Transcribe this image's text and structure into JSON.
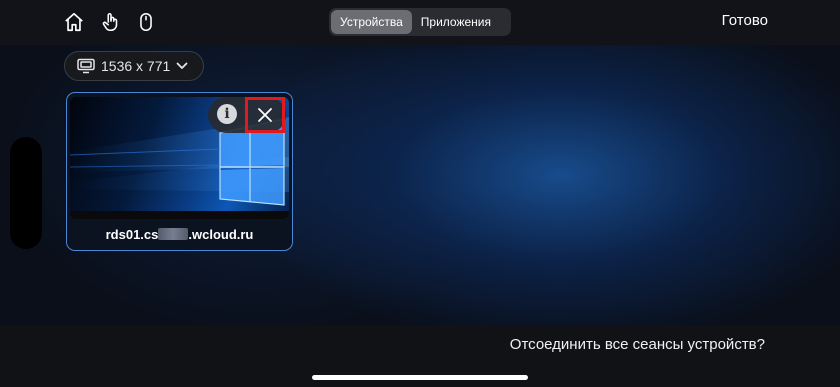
{
  "toolbar": {
    "icons": [
      "home-icon",
      "touch-hand-icon",
      "mouse-icon"
    ],
    "tabs": [
      {
        "label": "Устройства",
        "active": true
      },
      {
        "label": "Приложения",
        "active": false
      }
    ],
    "done_label": "Готово"
  },
  "resolution": {
    "label": "1536 x 771",
    "icon": "display-icon",
    "chevron": "chevron-down-icon"
  },
  "session_card": {
    "name_prefix": "rds01.cs",
    "name_suffix": ".wcloud.ru",
    "info_glyph": "i",
    "info_icon": "info-icon",
    "close_icon": "close-icon",
    "close_highlight_color": "#e2191e"
  },
  "footer": {
    "disconnect_all_label": "Отсоединить все сеансы устройств?"
  },
  "colors": {
    "accent_border": "#4a86d6",
    "active_tab": "#6b6d72"
  }
}
